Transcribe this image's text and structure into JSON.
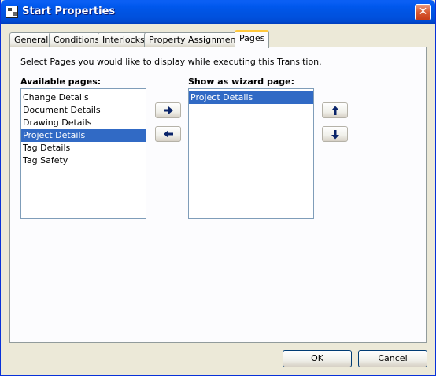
{
  "window": {
    "title": "Start Properties",
    "close_glyph": "✕"
  },
  "tabs": [
    {
      "label": "General"
    },
    {
      "label": "Conditions"
    },
    {
      "label": "Interlocks"
    },
    {
      "label": "Property Assignments"
    },
    {
      "label": "Pages",
      "active": true
    }
  ],
  "instruction": "Select Pages you would like to display while executing this Transition.",
  "available": {
    "label": "Available pages:",
    "items": [
      "Change Details",
      "Document Details",
      "Drawing Details",
      "Project Details",
      "Tag Details",
      "Tag Safety"
    ],
    "selected_index": 3
  },
  "wizard": {
    "label": "Show as wizard page:",
    "items": [
      "Project Details"
    ],
    "selected_index": 0
  },
  "buttons": {
    "ok": "OK",
    "cancel": "Cancel"
  },
  "icons": {
    "app": "properties-window-icon",
    "add": "arrow-right-icon",
    "remove": "arrow-left-icon",
    "move_up": "arrow-up-icon",
    "move_down": "arrow-down-icon"
  },
  "colors": {
    "titlebar": "#0054e3",
    "selection": "#316ac5",
    "active_tab_highlight": "#ffc83c",
    "arrow": "#0a246a"
  }
}
